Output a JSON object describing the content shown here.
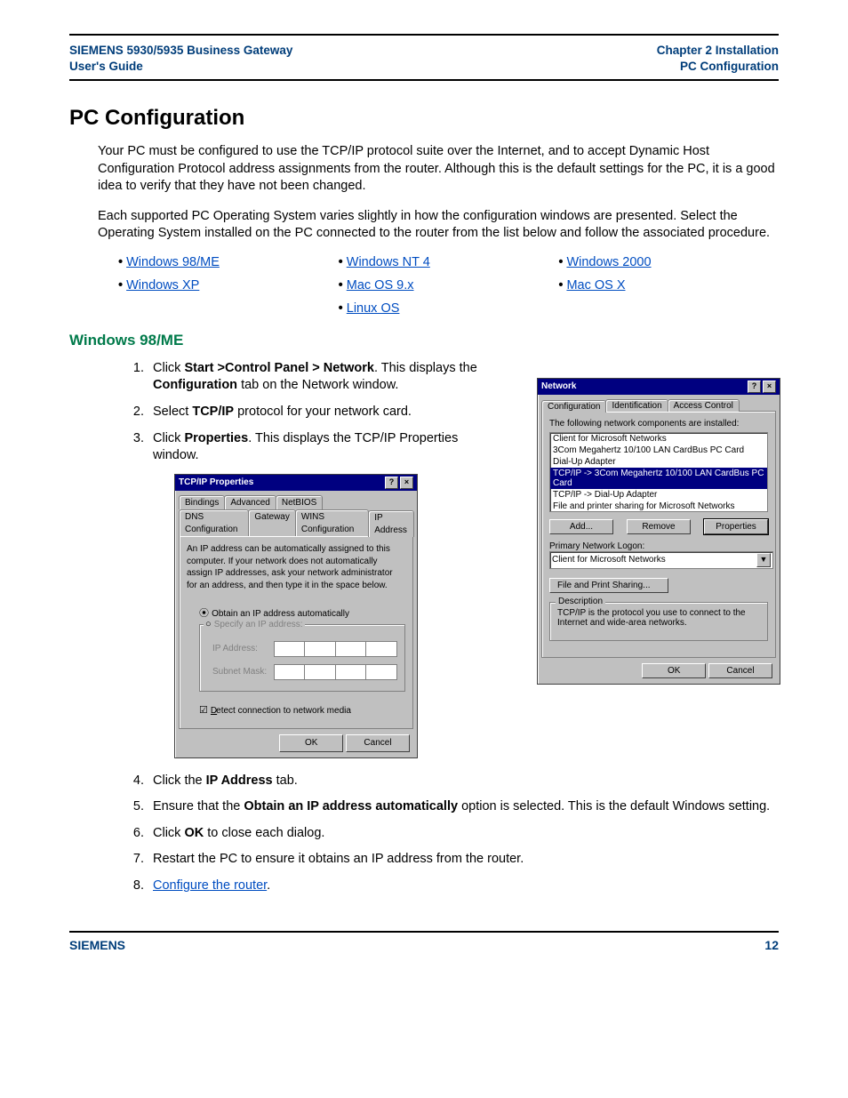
{
  "header": {
    "left_line1": "SIEMENS 5930/5935 Business Gateway",
    "left_line2": "User's Guide",
    "right_line1": "Chapter 2  Installation",
    "right_line2": "PC Configuration"
  },
  "title": "PC Configuration",
  "para1": "Your PC must be configured to use the TCP/IP protocol suite over the Internet, and to accept Dynamic Host Configuration Protocol address assignments from the router. Although this is the default settings for the PC, it is a good idea to verify that they have not been changed.",
  "para2": "Each supported PC Operating System varies slightly in how the configuration windows are presented. Select the Operating System installed on the PC connected to the router from the list below and follow the associated procedure.",
  "os_links": {
    "r1c1": "Windows 98/ME",
    "r1c2": "Windows NT 4",
    "r1c3": "Windows 2000",
    "r2c1": "Windows XP",
    "r2c2": "Mac OS 9.x",
    "r2c3": "Mac OS X",
    "r3c2": "Linux OS"
  },
  "sub_heading": "Windows 98/ME",
  "steps": {
    "s1_pre": "Click ",
    "s1_bold1": "Start >Control Panel > Network",
    "s1_mid": ". This displays the ",
    "s1_bold2": "Configuration",
    "s1_post": " tab on the Network window.",
    "s2_pre": "Select ",
    "s2_bold": "TCP/IP",
    "s2_post": " protocol for your network card.",
    "s3_pre": "Click ",
    "s3_bold": "Properties",
    "s3_post": ". This displays the TCP/IP Properties window.",
    "s4_pre": "Click the ",
    "s4_bold": "IP Address",
    "s4_post": " tab.",
    "s5_pre": "Ensure that the ",
    "s5_bold": "Obtain an IP address automatically",
    "s5_post": " option is selected. This is the default Windows setting.",
    "s6_pre": "Click ",
    "s6_bold": "OK",
    "s6_post": " to close each dialog.",
    "s7": "Restart the PC to ensure it obtains an IP address from the router.",
    "s8_link": "Configure the router",
    "s8_post": "."
  },
  "tcpip_dialog": {
    "title": "TCP/IP Properties",
    "tabs_row1": {
      "t1": "Bindings",
      "t2": "Advanced",
      "t3": "NetBIOS"
    },
    "tabs_row2": {
      "t1": "DNS Configuration",
      "t2": "Gateway",
      "t3": "WINS Configuration",
      "t4": "IP Address"
    },
    "intro": "An IP address can be automatically assigned to this computer. If your network does not automatically assign IP addresses, ask your network administrator for an address, and then type it in the space below.",
    "opt_auto": "Obtain an IP address automatically",
    "opt_specify": "Specify an IP address:",
    "lbl_ip": "IP Address:",
    "lbl_mask": "Subnet Mask:",
    "detect": "Detect connection to network media",
    "ok": "OK",
    "cancel": "Cancel"
  },
  "network_dialog": {
    "title": "Network",
    "tabs": {
      "t1": "Configuration",
      "t2": "Identification",
      "t3": "Access Control"
    },
    "intro": "The following network components are installed:",
    "items": {
      "i1": "Client for Microsoft Networks",
      "i2": "3Com Megahertz 10/100 LAN CardBus PC Card",
      "i3": "Dial-Up Adapter",
      "i4": "TCP/IP -> 3Com Megahertz 10/100 LAN CardBus PC Card",
      "i5": "TCP/IP -> Dial-Up Adapter",
      "i6": "File and printer sharing for Microsoft Networks"
    },
    "btn_add": "Add...",
    "btn_remove": "Remove",
    "btn_props": "Properties",
    "primary_label": "Primary Network Logon:",
    "primary_value": "Client for Microsoft Networks",
    "file_print": "File and Print Sharing...",
    "desc_legend": "Description",
    "desc_text": "TCP/IP is the protocol you use to connect to the Internet and wide-area networks.",
    "ok": "OK",
    "cancel": "Cancel"
  },
  "footer": {
    "left": "SIEMENS",
    "right": "12"
  }
}
